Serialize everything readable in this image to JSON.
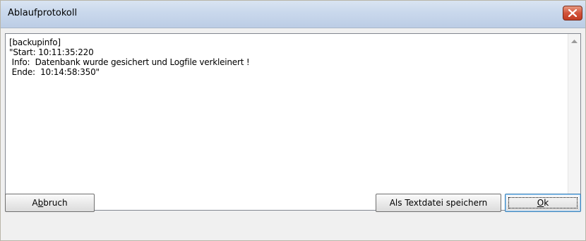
{
  "window": {
    "title": "Ablaufprotokoll"
  },
  "log": {
    "lines": [
      "[backupinfo]",
      "\"Start: 10:11:35:220",
      " Info:  Datenbank wurde gesichert und Logfile verkleinert !",
      " Ende:  10:14:58:350\""
    ]
  },
  "buttons": {
    "abort_pre": "A",
    "abort_mnemonic": "b",
    "abort_post": "bruch",
    "save_text": "Als Textdatei speichern",
    "ok_mnemonic": "O",
    "ok_post": "k"
  },
  "icons": {
    "close": "close-icon",
    "scroll_up": "arrow-up-icon",
    "scroll_down": "arrow-down-icon"
  },
  "colors": {
    "close_button": "#d2533b",
    "focus_border": "#3c7fb1"
  }
}
